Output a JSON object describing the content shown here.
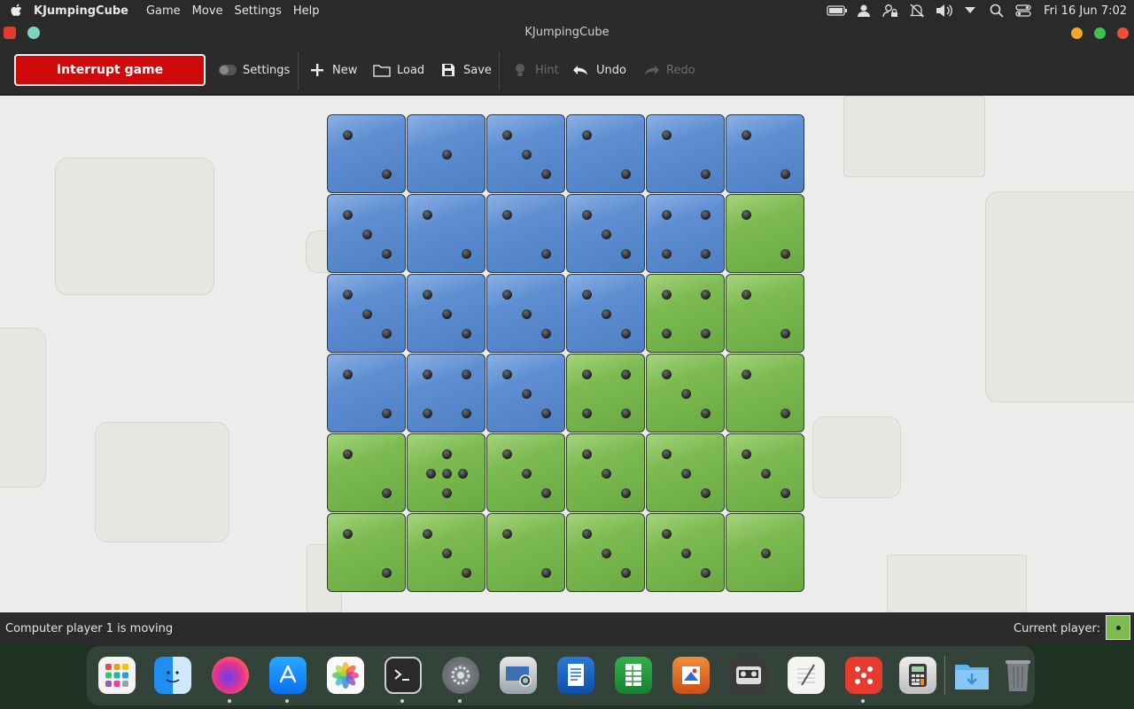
{
  "menubar": {
    "app_name": "KJumpingCube",
    "menus": [
      "Game",
      "Move",
      "Settings",
      "Help"
    ],
    "clock": "Fri 16 Jun 7:02",
    "icons": [
      "battery-icon",
      "user-icon",
      "user-lock-icon",
      "notifications-muted-icon",
      "volume-icon",
      "dropdown-icon",
      "search-icon",
      "control-center-icon"
    ]
  },
  "window": {
    "title": "KJumpingCube"
  },
  "toolbar": {
    "interrupt_label": "Interrupt game",
    "settings_label": "Settings",
    "new_label": "New",
    "load_label": "Load",
    "save_label": "Save",
    "hint_label": "Hint",
    "undo_label": "Undo",
    "redo_label": "Redo"
  },
  "colors": {
    "player1": "#5b8bd0",
    "player2": "#78b84c",
    "interrupt_button": "#d00a0a"
  },
  "board": {
    "rows": 6,
    "cols": 6,
    "cells": [
      [
        {
          "owner": "blue",
          "value": 2
        },
        {
          "owner": "blue",
          "value": 1
        },
        {
          "owner": "blue",
          "value": 3
        },
        {
          "owner": "blue",
          "value": 2
        },
        {
          "owner": "blue",
          "value": 2
        },
        {
          "owner": "blue",
          "value": 2
        }
      ],
      [
        {
          "owner": "blue",
          "value": 3
        },
        {
          "owner": "blue",
          "value": 2
        },
        {
          "owner": "blue",
          "value": 2
        },
        {
          "owner": "blue",
          "value": 3
        },
        {
          "owner": "blue",
          "value": 4
        },
        {
          "owner": "green",
          "value": 2
        }
      ],
      [
        {
          "owner": "blue",
          "value": 3
        },
        {
          "owner": "blue",
          "value": 3
        },
        {
          "owner": "blue",
          "value": 3
        },
        {
          "owner": "blue",
          "value": 3
        },
        {
          "owner": "green",
          "value": 4
        },
        {
          "owner": "green",
          "value": 2
        }
      ],
      [
        {
          "owner": "blue",
          "value": 2
        },
        {
          "owner": "blue",
          "value": 4
        },
        {
          "owner": "blue",
          "value": 3
        },
        {
          "owner": "green",
          "value": 4
        },
        {
          "owner": "green",
          "value": 3
        },
        {
          "owner": "green",
          "value": 2
        }
      ],
      [
        {
          "owner": "green",
          "value": 2
        },
        {
          "owner": "green",
          "value": 5
        },
        {
          "owner": "green",
          "value": 3
        },
        {
          "owner": "green",
          "value": 3
        },
        {
          "owner": "green",
          "value": 3
        },
        {
          "owner": "green",
          "value": 3
        }
      ],
      [
        {
          "owner": "green",
          "value": 2
        },
        {
          "owner": "green",
          "value": 3
        },
        {
          "owner": "green",
          "value": 2
        },
        {
          "owner": "green",
          "value": 3
        },
        {
          "owner": "green",
          "value": 3
        },
        {
          "owner": "green",
          "value": 1
        }
      ]
    ]
  },
  "status": {
    "message": "Computer player 1 is moving",
    "current_player_label": "Current player:",
    "current_player_value": 1
  },
  "dock": {
    "items": [
      {
        "name": "launchpad",
        "running": false
      },
      {
        "name": "finder",
        "running": true
      },
      {
        "name": "firefox",
        "running": true
      },
      {
        "name": "app-store",
        "running": false
      },
      {
        "name": "photos",
        "running": false
      },
      {
        "name": "terminal",
        "running": true
      },
      {
        "name": "system-settings",
        "running": true
      },
      {
        "name": "screenshot",
        "running": false
      },
      {
        "name": "text-editor",
        "running": false
      },
      {
        "name": "spreadsheet",
        "running": false
      },
      {
        "name": "drawing",
        "running": false
      },
      {
        "name": "media-player",
        "running": false
      },
      {
        "name": "notes",
        "running": false
      },
      {
        "name": "kjumpingcube",
        "running": true
      },
      {
        "name": "calculator",
        "running": false
      },
      {
        "name": "downloads",
        "running": false
      },
      {
        "name": "trash",
        "running": false
      }
    ]
  }
}
